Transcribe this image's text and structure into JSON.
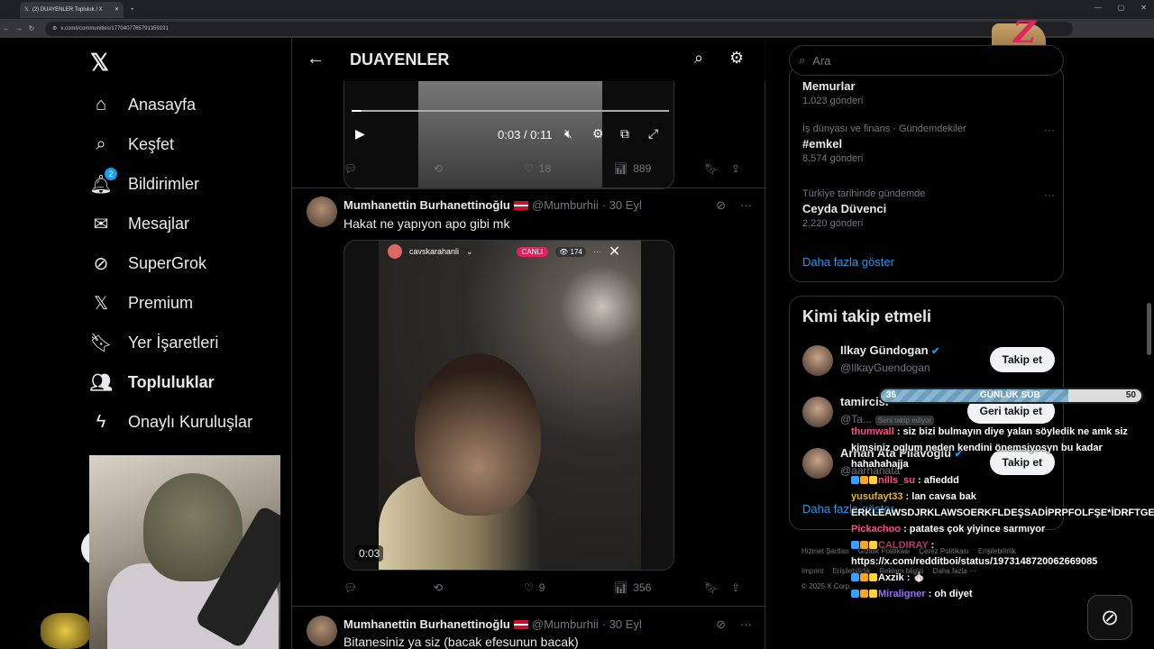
{
  "browser": {
    "tab_title": "(2) DUAYENLER Topluluk / X",
    "url": "x.com/i/communities/1770407765791359191"
  },
  "nav": {
    "items": [
      {
        "label": "Anasayfa",
        "icon": "home-icon"
      },
      {
        "label": "Keşfet",
        "icon": "search-icon"
      },
      {
        "label": "Bildirimler",
        "icon": "bell-icon",
        "badge": "2"
      },
      {
        "label": "Mesajlar",
        "icon": "mail-icon"
      },
      {
        "label": "SuperGrok",
        "icon": "grok-icon"
      },
      {
        "label": "Premium",
        "icon": "x-icon"
      },
      {
        "label": "Yer İşaretleri",
        "icon": "bookmark-icon"
      },
      {
        "label": "Topluluklar",
        "icon": "communities-icon"
      },
      {
        "label": "Onaylı Kuruluşlar",
        "icon": "lightning-icon"
      }
    ]
  },
  "header": {
    "title": "DUAYENLER"
  },
  "tweet1": {
    "video_time": "0:03 / 0:11",
    "video_progress": 0.03,
    "stats": {
      "reposts": "",
      "likes": "18",
      "views": "889"
    }
  },
  "tweet2": {
    "name": "Mumhanettin Burhanettinoğlu",
    "handle": "@Mumburhii",
    "date": "· 30 Eyl",
    "text": "Hakat ne yapıyon apo gibi mk",
    "live_user": "cavskarahanli",
    "live_badge": "CANLI",
    "viewers": "174",
    "video_time": "0:03",
    "stats": {
      "likes": "9",
      "views": "356"
    }
  },
  "tweet3": {
    "name": "Mumhanettin Burhanettinoğlu",
    "handle": "@Mumburhii",
    "date": "· 30 Eyl",
    "text": "Bitanesiniz ya siz (bacak efesunun bacak)"
  },
  "search": {
    "placeholder": "Ara"
  },
  "trends": {
    "top_partial": {
      "name": "Memurlar",
      "posts": "1.023 gönderi"
    },
    "items": [
      {
        "meta": "İş dünyası ve finans · Gündemdekiler",
        "name": "#emkel",
        "posts": "8.574 gönderi"
      },
      {
        "meta": "Türkiye tarihinde gündemde",
        "name": "Ceyda Düvenci",
        "posts": "2.220 gönderi"
      }
    ],
    "more": "Daha fazla göster"
  },
  "who_to_follow": {
    "title": "Kimi takip etmeli",
    "users": [
      {
        "name": "Ilkay Gündogan",
        "handle": "@IlkayGuendogan",
        "button": "Takip et",
        "verified": true
      },
      {
        "name": "tamircisi",
        "handle": "@Ta...",
        "tag": "Seni takip ediyor",
        "button": "Geri takip et",
        "verified": false
      },
      {
        "name": "Arhan Ata Pilavoğlu",
        "handle": "@aarhanata",
        "button": "Takip et",
        "verified": true
      }
    ],
    "more": "Daha fazla göster"
  },
  "footer": {
    "line1": [
      "Hizmet Şartları",
      "Gizlilik Politikası",
      "Çerez Politikası",
      "Erişilebilirlik"
    ],
    "line2": [
      "Imprint",
      "Erişilebilirlik",
      "Reklam bilgisi",
      "Daha fazla ···"
    ],
    "copyright": "© 2025 X Corp."
  },
  "overlay": {
    "sub_bar": {
      "left": "36",
      "center": "GÜNLÜK SUB",
      "right": "50",
      "progress": 0.72
    },
    "chat": [
      {
        "user": "thumwall",
        "text": ": siz bizi bulmayın diye yalan söyledik ne amk siz kimsiniz oglum neden kendini önemsiyosyn bu kadar",
        "color": "#ff4b8a"
      },
      {
        "user": "",
        "text": "hahahahajja",
        "color": "#ffffff"
      },
      {
        "user": "nills_su",
        "text": ": afieddd",
        "color": "#ff4b8a",
        "badges": true
      },
      {
        "user": "yusufayt33",
        "text": ": lan cavsa bak ERKLEAWSDJRKLAWSOERKFLDEŞSADİPRPFOLFŞE*İDRFTGESD",
        "color": "#e6b422"
      },
      {
        "user": "Pickachoo",
        "text": ": patates çok yiyince sarmıyor",
        "color": "#ff4b8a"
      },
      {
        "user": "CALDIRAY",
        "text": ": https://x.com/redditboi/status/1973148720062669085",
        "color": "#c0306b",
        "badges": true
      },
      {
        "user": "Axzik",
        "text": ": 🧄",
        "color": "#ffffff",
        "badges": true
      },
      {
        "user": "Miraligner",
        "text": ": oh diyet",
        "color": "#9b6bff",
        "badges": true
      }
    ]
  },
  "colors": {
    "accent": "#1d9bf0",
    "bg": "#000000",
    "border": "#2f3336",
    "muted": "#71767b"
  }
}
